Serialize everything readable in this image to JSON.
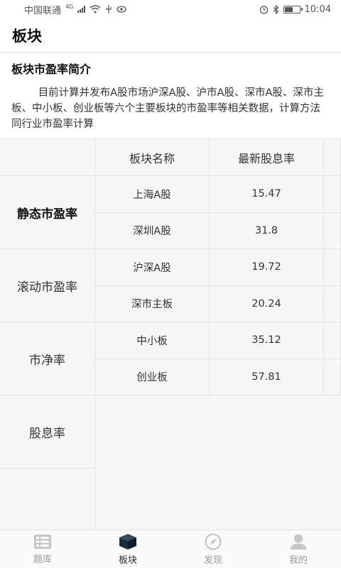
{
  "status": {
    "carrier": "中国联通",
    "network": "4G",
    "time": "10:04",
    "battery_level": 0.6
  },
  "header": {
    "title": "板块"
  },
  "intro": {
    "title": "板块市盈率简介",
    "text": "目前计算并发布A股市场沪深A股、沪市A股、深市A股、深市主板、中小板、创业板等六个主要板块的市盈率等相关数据，计算方法同行业市盈率计算"
  },
  "categories": [
    {
      "label": "静态市盈率",
      "active": true
    },
    {
      "label": "滚动市盈率",
      "active": false
    },
    {
      "label": "市净率",
      "active": false
    },
    {
      "label": "股息率",
      "active": false
    }
  ],
  "table": {
    "headers": [
      "板块名称",
      "最新股息率"
    ],
    "rows": [
      [
        "上海A股",
        "15.47"
      ],
      [
        "深圳A股",
        "31.8"
      ],
      [
        "沪深A股",
        "19.72"
      ],
      [
        "深市主板",
        "20.24"
      ],
      [
        "中小板",
        "35.12"
      ],
      [
        "创业板",
        "57.81"
      ]
    ]
  },
  "tabs": [
    {
      "label": "题库",
      "icon": "list-icon",
      "active": false
    },
    {
      "label": "板块",
      "icon": "cube-icon",
      "active": true
    },
    {
      "label": "发现",
      "icon": "compass-icon",
      "active": false
    },
    {
      "label": "我的",
      "icon": "user-icon",
      "active": false
    }
  ],
  "colors": {
    "active": "#1b2a3d",
    "inactive": "#c6c6c6"
  }
}
